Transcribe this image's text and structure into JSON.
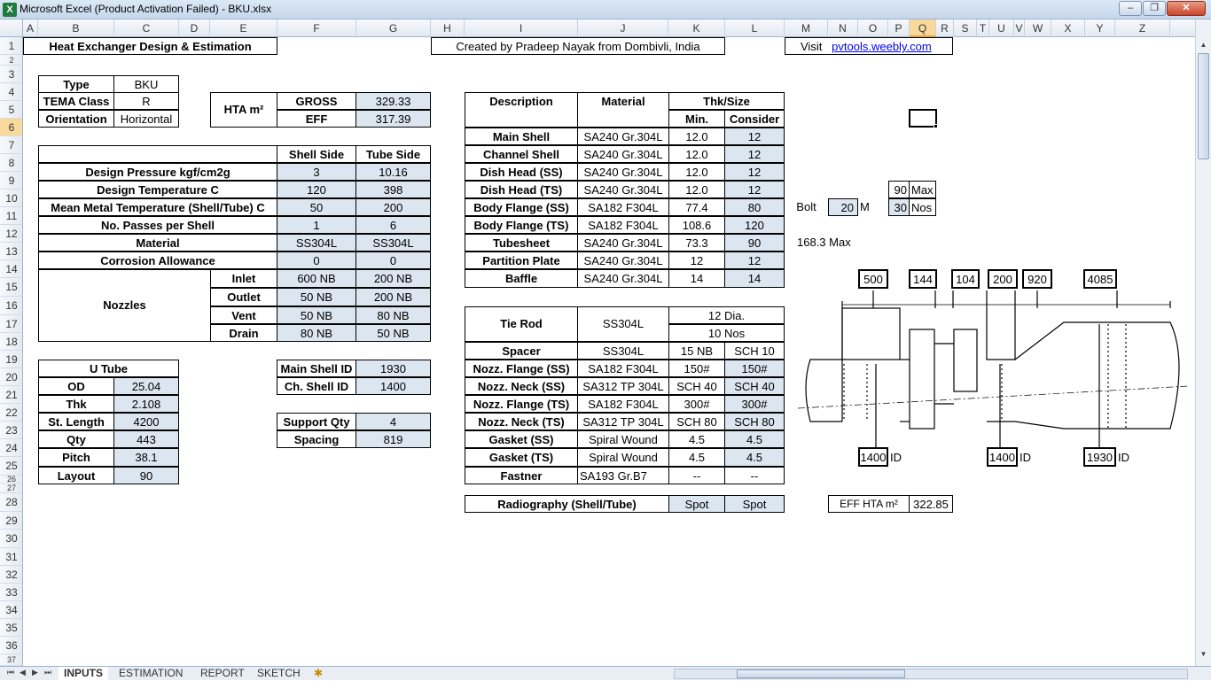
{
  "window": {
    "title": "Microsoft Excel (Product Activation Failed) - BKU.xlsx",
    "app_icon": "X",
    "buttons": {
      "minimize": "–",
      "restore": "❐",
      "close": "✕"
    }
  },
  "columns": [
    "A",
    "B",
    "C",
    "D",
    "E",
    "F",
    "G",
    "H",
    "I",
    "J",
    "K",
    "L",
    "M",
    "N",
    "O",
    "P",
    "Q",
    "R",
    "S",
    "T",
    "U",
    "V",
    "W",
    "X",
    "Y",
    "Z"
  ],
  "rows": [
    "1",
    "2",
    "3",
    "4",
    "5",
    "6",
    "7",
    "8",
    "9",
    "10",
    "11",
    "12",
    "13",
    "14",
    "15",
    "16",
    "17",
    "18",
    "19",
    "20",
    "21",
    "22",
    "23",
    "24",
    "25",
    "26",
    "27",
    "28",
    "29",
    "30",
    "31",
    "32",
    "33",
    "34",
    "35",
    "36",
    "37"
  ],
  "header": {
    "title": "Heat Exchanger Design & Estimation",
    "credit": "Created by Pradeep Nayak from Dombivli, India",
    "visit": "Visit",
    "link": "pvtools.weebly.com"
  },
  "type_block": {
    "type_label": "Type",
    "type_value": "BKU",
    "tema_label": "TEMA Class",
    "tema_value": "R",
    "orient_label": "Orientation",
    "orient_value": "Horizontal"
  },
  "hta": {
    "label": "HTA   m²",
    "gross_label": "GROSS",
    "gross_value": "329.33",
    "eff_label": "EFF",
    "eff_value": "317.39"
  },
  "design": {
    "shell_header": "Shell Side",
    "tube_header": "Tube Side",
    "rows": [
      {
        "label": "Design Pressure     kgf/cm2g",
        "shell": "3",
        "tube": "10.16"
      },
      {
        "label": "Design Temperature    C",
        "shell": "120",
        "tube": "398"
      },
      {
        "label": "Mean Metal Temperature (Shell/Tube)  C",
        "shell": "50",
        "tube": "200"
      },
      {
        "label": "No. Passes per Shell",
        "shell": "1",
        "tube": "6"
      },
      {
        "label": "Material",
        "shell": "SS304L",
        "tube": "SS304L"
      },
      {
        "label": "Corrosion Allowance",
        "shell": "0",
        "tube": "0"
      }
    ],
    "nozzles_label": "Nozzles",
    "nozzles": [
      {
        "label": "Inlet",
        "shell": "600 NB",
        "tube": "200 NB"
      },
      {
        "label": "Outlet",
        "shell": "50 NB",
        "tube": "200 NB"
      },
      {
        "label": "Vent",
        "shell": "50 NB",
        "tube": "80 NB"
      },
      {
        "label": "Drain",
        "shell": "80 NB",
        "tube": "50 NB"
      }
    ]
  },
  "utube": {
    "title": "U Tube",
    "rows": [
      {
        "label": "OD",
        "value": "25.04"
      },
      {
        "label": "Thk",
        "value": "2.108"
      },
      {
        "label": "St. Length",
        "value": "4200"
      },
      {
        "label": "Qty",
        "value": "443"
      },
      {
        "label": "Pitch",
        "value": "38.1"
      },
      {
        "label": "Layout",
        "value": "90"
      }
    ]
  },
  "shell_id": {
    "main_label": "Main Shell ID",
    "main_value": "1930",
    "ch_label": "Ch. Shell ID",
    "ch_value": "1400"
  },
  "support": {
    "qty_label": "Support Qty",
    "qty_value": "4",
    "spacing_label": "Spacing",
    "spacing_value": "819"
  },
  "materials": {
    "desc_header": "Description",
    "mat_header": "Material",
    "thk_header": "Thk/Size",
    "min_header": "Min.",
    "consider_header": "Consider",
    "rows": [
      {
        "desc": "Main Shell",
        "mat": "SA240 Gr.304L",
        "min": "12.0",
        "consider": "12"
      },
      {
        "desc": "Channel Shell",
        "mat": "SA240 Gr.304L",
        "min": "12.0",
        "consider": "12"
      },
      {
        "desc": "Dish Head (SS)",
        "mat": "SA240 Gr.304L",
        "min": "12.0",
        "consider": "12"
      },
      {
        "desc": "Dish Head (TS)",
        "mat": "SA240 Gr.304L",
        "min": "12.0",
        "consider": "12"
      },
      {
        "desc": "Body Flange (SS)",
        "mat": "SA182 F304L",
        "min": "77.4",
        "consider": "80"
      },
      {
        "desc": "Body Flange (TS)",
        "mat": "SA182 F304L",
        "min": "108.6",
        "consider": "120"
      },
      {
        "desc": "Tubesheet",
        "mat": "SA240 Gr.304L",
        "min": "73.3",
        "consider": "90"
      },
      {
        "desc": "Partition Plate",
        "mat": "SA240 Gr.304L",
        "min": "12",
        "consider": "12"
      },
      {
        "desc": "Baffle",
        "mat": "SA240 Gr.304L",
        "min": "14",
        "consider": "14"
      }
    ]
  },
  "bolt": {
    "label": "Bolt",
    "size": "20",
    "size_unit": "M",
    "max_value": "90",
    "max_label": "Max",
    "nos_value": "30",
    "nos_label": "Nos",
    "tubesheet_max": "168.3  Max"
  },
  "fittings": {
    "tie_rod_label": "Tie Rod",
    "tie_rod_mat": "SS304L",
    "tie_rod_dia": "12 Dia.",
    "tie_rod_nos": "10 Nos",
    "rows": [
      {
        "desc": "Spacer",
        "mat": "SS304L",
        "min": "15 NB",
        "consider": "SCH 10"
      },
      {
        "desc": "Nozz. Flange (SS)",
        "mat": "SA182 F304L",
        "min": "150#",
        "consider": "150#"
      },
      {
        "desc": "Nozz. Neck (SS)",
        "mat": "SA312 TP 304L",
        "min": "SCH 40",
        "consider": "SCH 40"
      },
      {
        "desc": "Nozz. Flange (TS)",
        "mat": "SA182 F304L",
        "min": "300#",
        "consider": "300#"
      },
      {
        "desc": "Nozz. Neck (TS)",
        "mat": "SA312 TP 304L",
        "min": "SCH 80",
        "consider": "SCH 80"
      },
      {
        "desc": "Gasket (SS)",
        "mat": "Spiral Wound",
        "min": "4.5",
        "consider": "4.5"
      },
      {
        "desc": "Gasket (TS)",
        "mat": "Spiral Wound",
        "min": "4.5",
        "consider": "4.5"
      },
      {
        "desc": "Fastner",
        "mat": "SA193 Gr.B7",
        "min": "--",
        "consider": "--"
      }
    ]
  },
  "radiography": {
    "label": "Radiography (Shell/Tube)",
    "shell": "Spot",
    "tube": "Spot"
  },
  "eff_hta": {
    "label": "EFF HTA m²",
    "value": "322.85"
  },
  "sketch": {
    "dims_top": [
      "500",
      "144",
      "104",
      "200",
      "920",
      "4085"
    ],
    "dims_bottom": [
      {
        "value": "1400",
        "unit": "ID"
      },
      {
        "value": "1400",
        "unit": "ID"
      },
      {
        "value": "1930",
        "unit": "ID"
      }
    ]
  },
  "tabs": [
    "INPUTS",
    "ESTIMATION",
    "REPORT",
    "SKETCH"
  ],
  "active_tab": "INPUTS",
  "selected_cell": "Q6"
}
